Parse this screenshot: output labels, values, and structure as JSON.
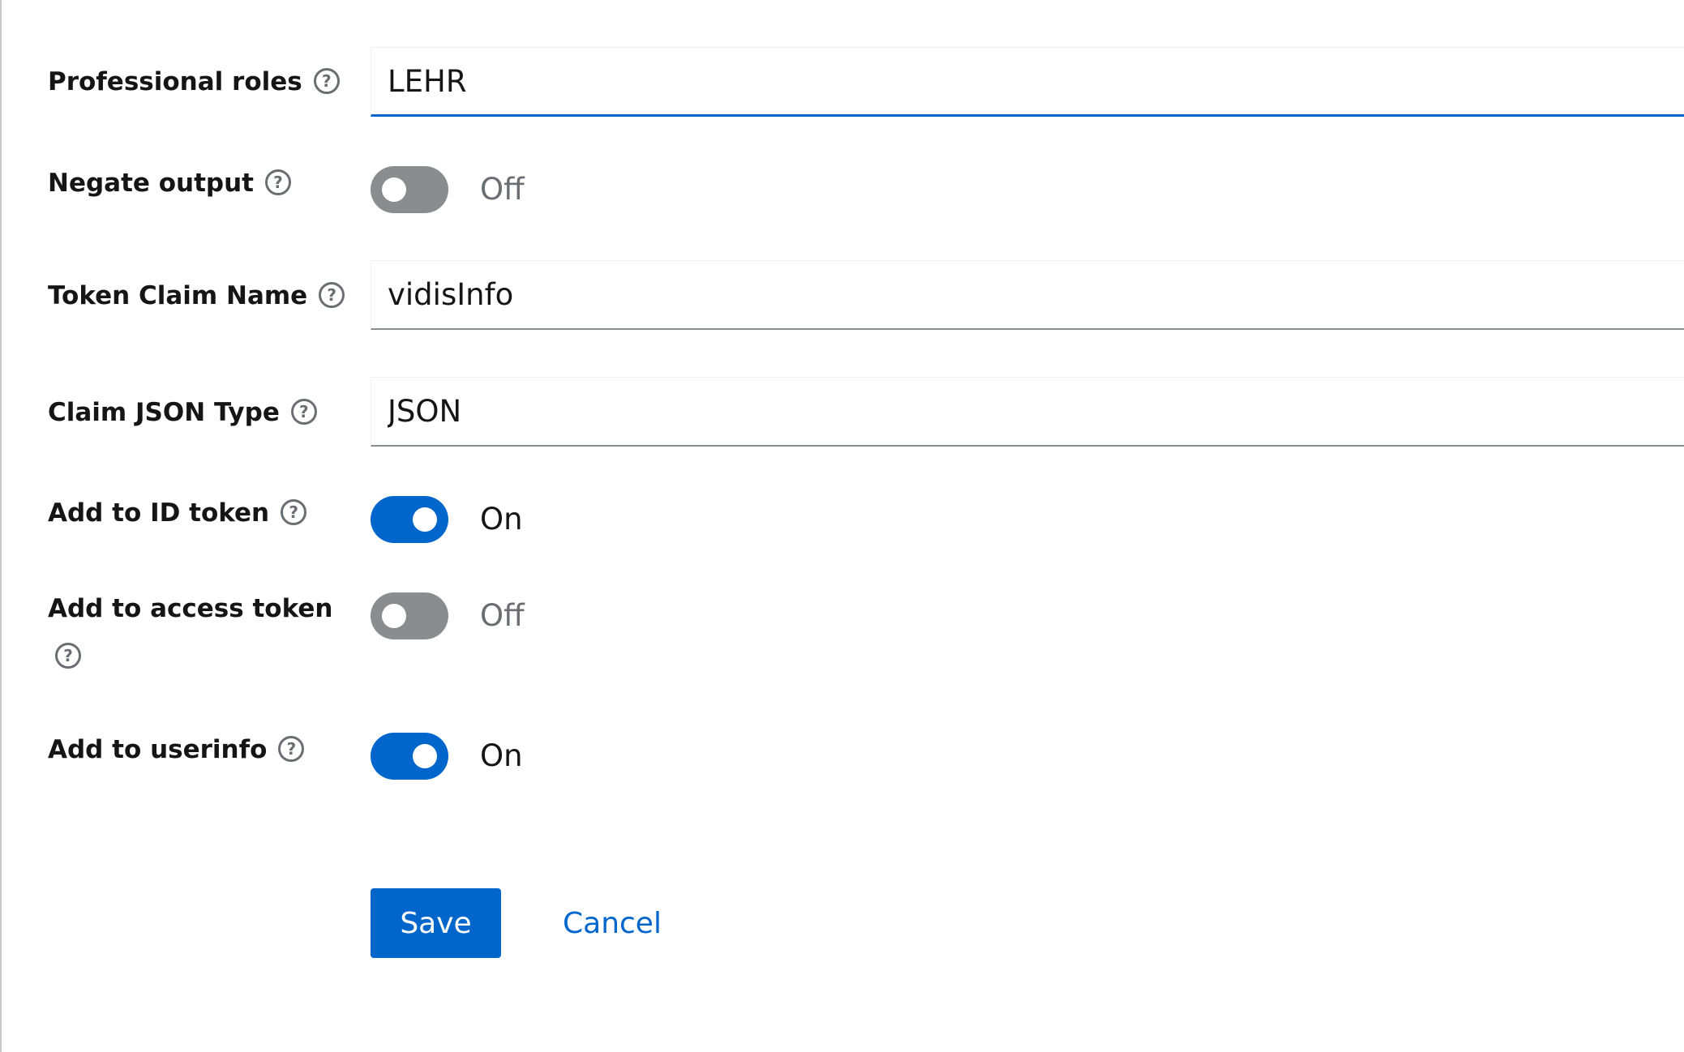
{
  "fields": {
    "professional_roles": {
      "label": "Professional roles",
      "value": "LEHR"
    },
    "negate_output": {
      "label": "Negate output",
      "state": "Off"
    },
    "token_claim_name": {
      "label": "Token Claim Name",
      "value": "vidisInfo"
    },
    "claim_json_type": {
      "label": "Claim JSON Type",
      "value": "JSON"
    },
    "add_to_id_token": {
      "label": "Add to ID token",
      "state": "On"
    },
    "add_to_access_token": {
      "label": "Add to access token",
      "state": "Off"
    },
    "add_to_userinfo": {
      "label": "Add to userinfo",
      "state": "On"
    }
  },
  "help_icon_glyph": "?",
  "actions": {
    "save_label": "Save",
    "cancel_label": "Cancel"
  },
  "colors": {
    "accent": "#0066cc",
    "switch_off": "#8a8d90",
    "text": "#151515",
    "muted": "#6a6e73"
  }
}
